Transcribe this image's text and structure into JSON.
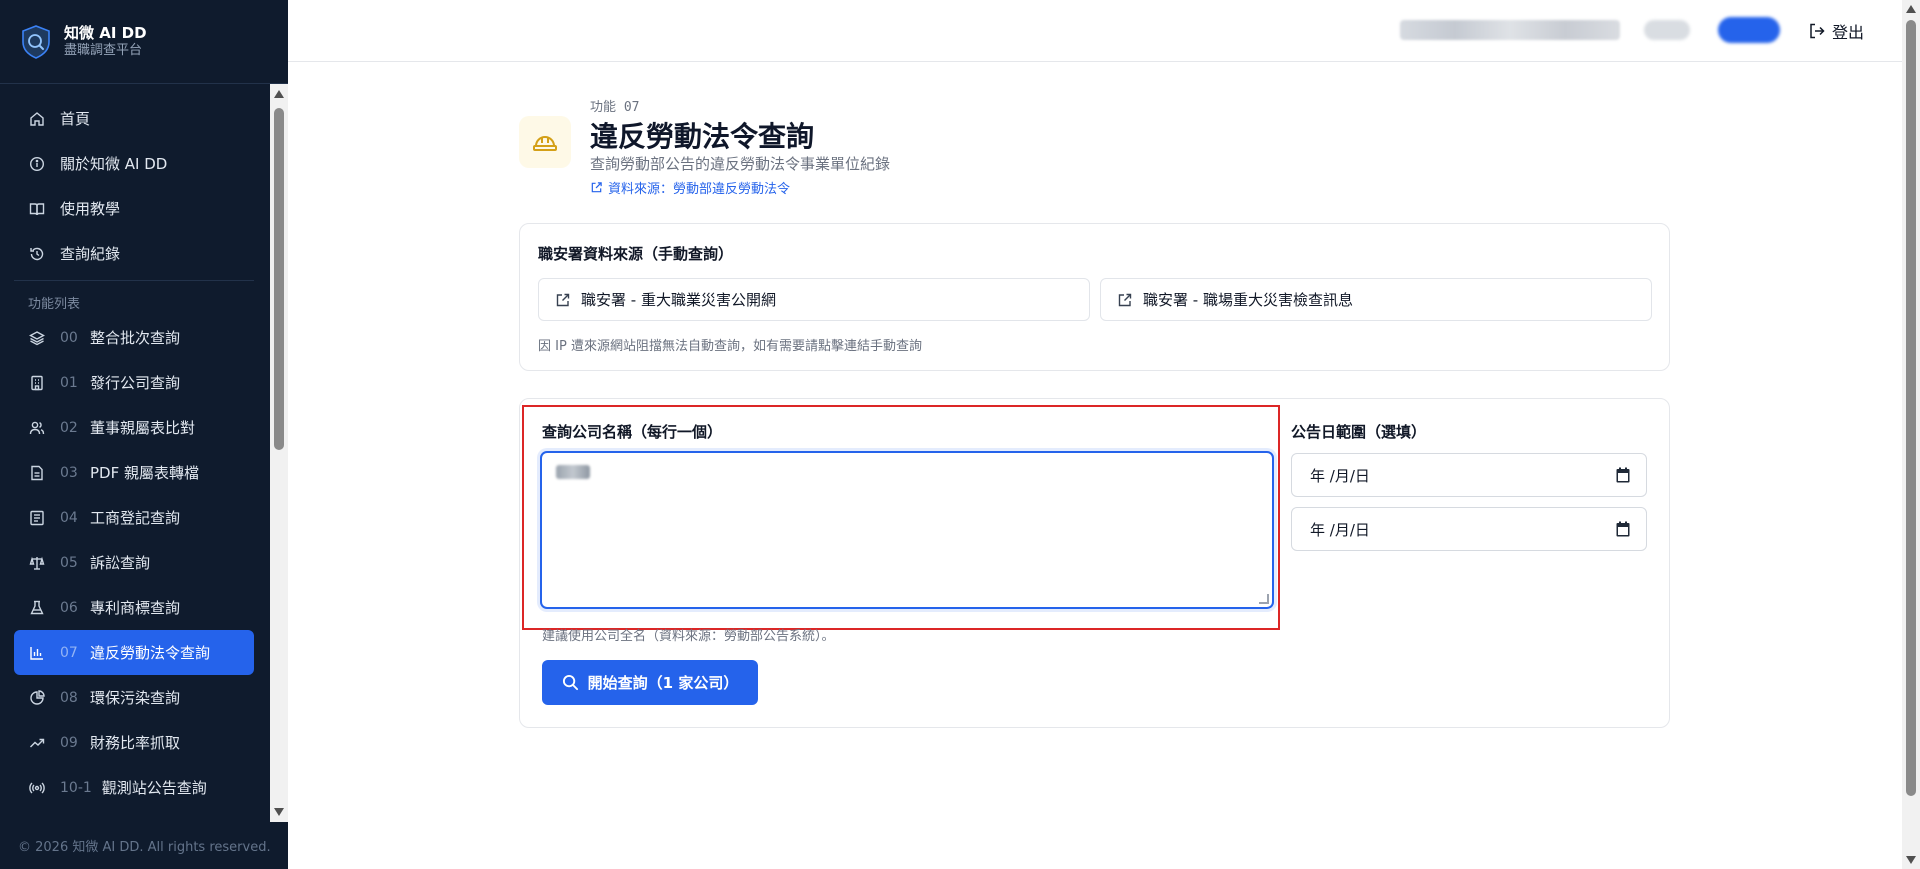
{
  "brand": {
    "title": "知微 AI DD",
    "subtitle": "盡職調查平台"
  },
  "nav": {
    "main": [
      {
        "label": "首頁",
        "icon": "home-icon"
      },
      {
        "label": "關於知微 AI DD",
        "icon": "info-icon"
      },
      {
        "label": "使用教學",
        "icon": "book-icon"
      },
      {
        "label": "查詢紀錄",
        "icon": "history-icon"
      }
    ],
    "section_label": "功能列表",
    "features": [
      {
        "num": "00",
        "label": "整合批次查詢",
        "icon": "layers-icon"
      },
      {
        "num": "01",
        "label": "發行公司查詢",
        "icon": "building-icon"
      },
      {
        "num": "02",
        "label": "董事親屬表比對",
        "icon": "users-icon"
      },
      {
        "num": "03",
        "label": "PDF 親屬表轉檔",
        "icon": "file-icon"
      },
      {
        "num": "04",
        "label": "工商登記查詢",
        "icon": "register-icon"
      },
      {
        "num": "05",
        "label": "訴訟查詢",
        "icon": "scale-icon"
      },
      {
        "num": "06",
        "label": "專利商標查詢",
        "icon": "flask-icon"
      },
      {
        "num": "07",
        "label": "違反勞動法令查詢",
        "icon": "bar-chart-icon",
        "active": true
      },
      {
        "num": "08",
        "label": "環保污染查詢",
        "icon": "pie-icon"
      },
      {
        "num": "09",
        "label": "財務比率抓取",
        "icon": "trend-icon"
      },
      {
        "num": "10-1",
        "label": "觀測站公告查詢",
        "icon": "broadcast-icon"
      }
    ]
  },
  "footer": {
    "copyright": "© 2026 知微 AI DD. All rights reserved."
  },
  "topbar": {
    "logout_label": "登出"
  },
  "header": {
    "feature_code": "功能 07",
    "title": "違反勞動法令查詢",
    "subtitle": "查詢勞動部公告的違反勞動法令事業單位紀錄",
    "source_link": "資料來源：勞動部違反勞動法令"
  },
  "manual_sources": {
    "title": "職安署資料來源（手動查詢）",
    "buttons": [
      "職安署 - 重大職業災害公開網",
      "職安署 - 職場重大災害檢查訊息"
    ],
    "note": "因 IP 遭來源網站阻擋無法自動查詢，如有需要請點擊連結手動查詢"
  },
  "form": {
    "company_label": "查詢公司名稱（每行一個）",
    "date_label": "公告日範圍（選填）",
    "date_from_placeholder": "年 /月/日",
    "date_to_placeholder": "年 /月/日",
    "hint": "建議使用公司全名（資料來源：勞動部公告系統）。",
    "submit_label": "開始查詢（1 家公司）"
  },
  "colors": {
    "accent": "#2563eb",
    "sidebar_bg": "#0f1b2d",
    "highlight": "#dc2626",
    "feature_icon_bg": "#fef9e7",
    "feature_icon": "#d4a017"
  }
}
